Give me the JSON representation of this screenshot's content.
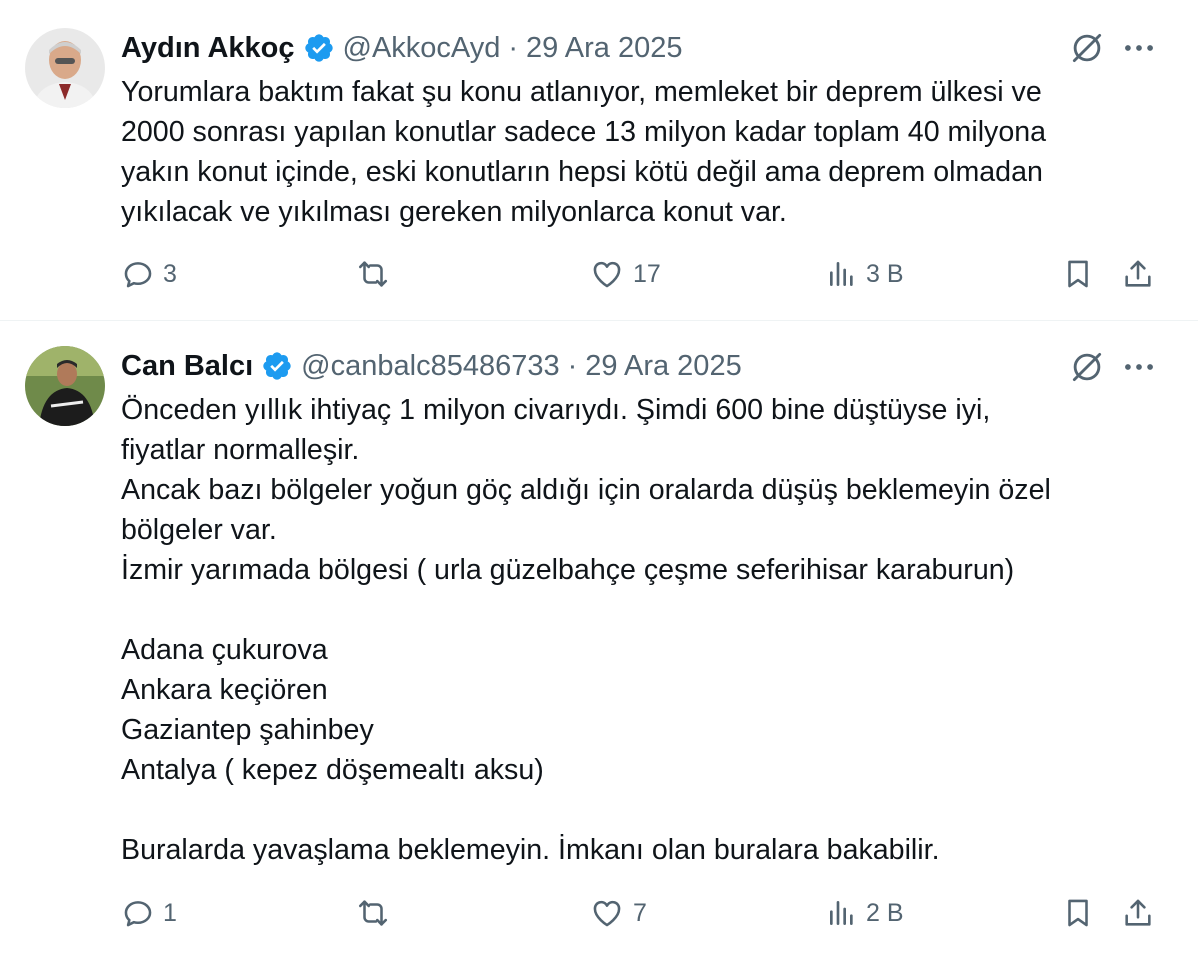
{
  "tweets": [
    {
      "author_name": "Aydın Akkoç",
      "handle": "@AkkocAyd",
      "separator": "·",
      "date": "29 Ara 2025",
      "body": [
        "Yorumlara baktım fakat şu konu atlanıyor, memleket bir deprem ülkesi ve",
        "2000 sonrası yapılan konutlar sadece 13 milyon kadar toplam 40 milyona",
        "yakın konut içinde, eski konutların hepsi kötü değil ama deprem olmadan",
        "yıkılacak ve yıkılması gereken milyonlarca konut var."
      ],
      "replies": "3",
      "reposts": "",
      "likes": "17",
      "views": "3 B"
    },
    {
      "author_name": "Can Balcı",
      "handle": "@canbalc85486733",
      "separator": "·",
      "date": "29 Ara 2025",
      "body": [
        "Önceden yıllık ihtiyaç 1 milyon civarıydı. Şimdi 600 bine düştüyse iyi,",
        "fiyatlar normalleşir.",
        "Ancak bazı bölgeler yoğun göç aldığı için oralarda düşüş beklemeyin özel",
        "bölgeler var.",
        "İzmir yarımada bölgesi ( urla güzelbahçe çeşme seferihisar karaburun)",
        "",
        "Adana çukurova",
        "Ankara keçiören",
        "Gaziantep şahinbey",
        "Antalya ( kepez döşemealtı aksu)",
        "",
        "Buralarda yavaşlama beklemeyin. İmkanı olan buralara bakabilir."
      ],
      "replies": "1",
      "reposts": "",
      "likes": "7",
      "views": "2 B"
    }
  ],
  "colors": {
    "text": "#0f1419",
    "secondary": "#536471",
    "verified": "#1d9bf0",
    "divider": "#eff3f4"
  },
  "icons": [
    "verified-badge-icon",
    "grok-icon",
    "more-icon",
    "reply-icon",
    "repost-icon",
    "like-icon",
    "views-icon",
    "bookmark-icon",
    "share-icon"
  ]
}
